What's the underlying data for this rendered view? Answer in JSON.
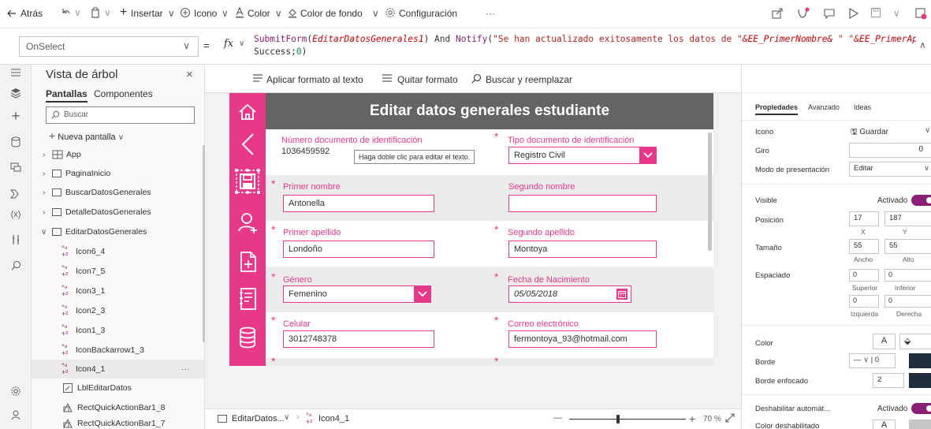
{
  "toolbar": {
    "back": "Atrás",
    "insert": "Insertar",
    "icon": "Icono",
    "color": "Color",
    "bg_color": "Color de fondo",
    "settings": "Configuración",
    "more": "···"
  },
  "formula_bar": {
    "property": "OnSelect",
    "fx": "fx",
    "formula_1": "SubmitForm",
    "formula_2": "EditarDatosGenerales1",
    "formula_3": ") And ",
    "formula_4": "Notify",
    "formula_5": "\"Se han actualizado exitosamente los datos de \"",
    "formula_6": "&EE_PrimerNombre&",
    "formula_7": "\" \"",
    "formula_8": "&EE_PrimerApellido;",
    "formula_line2a": "Success;",
    "formula_line2b": "0",
    "formula_line2c": ")"
  },
  "format_bar": {
    "format_text": "Aplicar formato al texto",
    "remove_format": "Quitar formato",
    "find_replace": "Buscar y reemplazar"
  },
  "tree": {
    "title": "Vista de árbol",
    "tab_screens": "Pantallas",
    "tab_components": "Componentes",
    "search_placeholder": "Buscar",
    "new_screen": "Nueva pantalla",
    "items": [
      "App",
      "PaginaInicio",
      "BuscarDatosGenerales",
      "DetalleDatosGenerales",
      "EditarDatosGenerales",
      "Icon6_4",
      "Icon7_5",
      "Icon3_1",
      "Icon2_3",
      "Icon1_3",
      "IconBackarrow1_3",
      "Icon4_1",
      "LblEditarDatos",
      "RectQuickActionBar1_8",
      "RectQuickActionBar1_7"
    ],
    "ellipsis": "···"
  },
  "form": {
    "title": "Editar datos generales estudiante",
    "doc_num_label": "Número documento de identificación",
    "doc_num_value": "1036459592",
    "tooltip": "Haga doble clic para editar el texto.",
    "doc_type_label": "Tipo documento de identificación",
    "doc_type_value": "Registro Civil",
    "first_name_label": "Primer nombre",
    "first_name_value": "Antonella",
    "second_name_label": "Segundo nombre",
    "second_name_value": "",
    "first_last_label": "Primer apellido",
    "first_last_value": "Londoño",
    "second_last_label": "Segundo apellido",
    "second_last_value": "Montoya",
    "gender_label": "Género",
    "gender_value": "Femenino",
    "birth_label": "Fecha de Nacimiento",
    "birth_value": "05/05/2018",
    "phone_label": "Celular",
    "phone_value": "3012748378",
    "email_label": "Correo electrónico",
    "email_value": "fermontoya_93@hotmail.com"
  },
  "bottom_bar": {
    "screen_crumb": "EditarDatos...",
    "control_crumb": "Icon4_1",
    "zoom_minus": "—",
    "zoom_plus": "+",
    "zoom": "70 %"
  },
  "props": {
    "tab_properties": "Propiedades",
    "tab_advanced": "Avanzado",
    "tab_ideas": "Ideas",
    "icon_label": "Icono",
    "icon_value": "Guardar",
    "rotation_label": "Giro",
    "rotation_value": "0",
    "display_mode_label": "Modo de presentación",
    "display_mode_value": "Editar",
    "visible_label": "Visible",
    "visible_value": "Activado",
    "position_label": "Posición",
    "pos_x": "17",
    "pos_y": "187",
    "x_label": "X",
    "y_label": "Y",
    "size_label": "Tamaño",
    "width": "55",
    "height": "55",
    "width_label": "Ancho",
    "height_label": "Alto",
    "padding_label": "Espaciado",
    "pad_top": "0",
    "pad_bottom": "0",
    "top_label": "Superior",
    "bottom_label": "Inferior",
    "pad_left": "0",
    "pad_right": "0",
    "left_label": "Izquierda",
    "right_label": "Derecha",
    "color_label": "Color",
    "color_a": "A",
    "border_label": "Borde",
    "border_value": "0",
    "focus_border_label": "Borde enfocado",
    "focus_border_value": "2",
    "auto_disable_label": "Deshabilitar automát...",
    "auto_disable_value": "Activado",
    "disabled_color_label": "Color deshabilitado",
    "disabled_color_a": "A"
  },
  "colors": {
    "accent": "#e8388a",
    "header_gray": "#646464",
    "toggle": "#8a1f73"
  }
}
